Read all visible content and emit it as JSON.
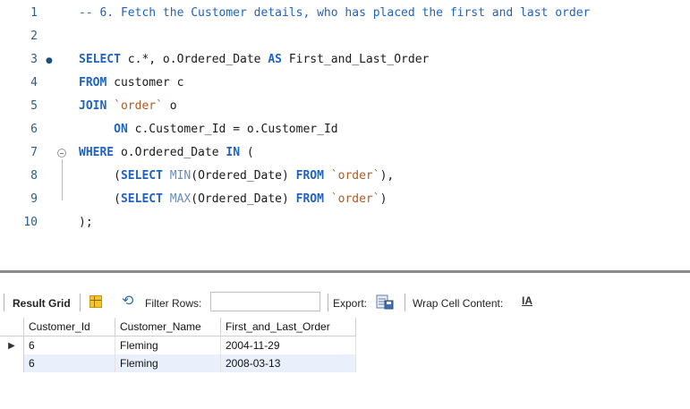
{
  "editor": {
    "lines": [
      {
        "num": "1",
        "tokens": [
          [
            "cm",
            "-- 6. Fetch the Customer details, who has placed the first and last order"
          ]
        ]
      },
      {
        "num": "2",
        "tokens": []
      },
      {
        "num": "3",
        "tokens": [
          [
            "kw",
            "SELECT"
          ],
          [
            "",
            " c.*, o.Ordered_Date "
          ],
          [
            "kw",
            "AS"
          ],
          [
            "",
            " First_and_Last_Order"
          ]
        ]
      },
      {
        "num": "4",
        "tokens": [
          [
            "kw",
            "FROM"
          ],
          [
            "",
            " customer c"
          ]
        ]
      },
      {
        "num": "5",
        "tokens": [
          [
            "kw",
            "JOIN"
          ],
          [
            "",
            " "
          ],
          [
            "str",
            "`order`"
          ],
          [
            "",
            " o"
          ]
        ]
      },
      {
        "num": "6",
        "tokens": [
          [
            "",
            "     "
          ],
          [
            "kw",
            "ON"
          ],
          [
            "",
            " c.Customer_Id = o.Customer_Id"
          ]
        ]
      },
      {
        "num": "7",
        "tokens": [
          [
            "kw",
            "WHERE"
          ],
          [
            "",
            " o.Ordered_Date "
          ],
          [
            "kw",
            "IN"
          ],
          [
            "",
            " ("
          ]
        ]
      },
      {
        "num": "8",
        "tokens": [
          [
            "",
            "     ("
          ],
          [
            "kw",
            "SELECT"
          ],
          [
            "",
            " "
          ],
          [
            "fn",
            "MIN"
          ],
          [
            "",
            "(Ordered_Date) "
          ],
          [
            "kw",
            "FROM"
          ],
          [
            "",
            " "
          ],
          [
            "str",
            "`order`"
          ],
          [
            "",
            "),"
          ]
        ]
      },
      {
        "num": "9",
        "tokens": [
          [
            "",
            "     ("
          ],
          [
            "kw",
            "SELECT"
          ],
          [
            "",
            " "
          ],
          [
            "fn",
            "MAX"
          ],
          [
            "",
            "(Ordered_Date) "
          ],
          [
            "kw",
            "FROM"
          ],
          [
            "",
            " "
          ],
          [
            "str",
            "`order`"
          ],
          [
            "",
            ")"
          ]
        ]
      },
      {
        "num": "10",
        "tokens": [
          [
            "",
            ");"
          ]
        ]
      }
    ]
  },
  "toolbar": {
    "result_grid_label": "Result Grid",
    "filter_rows_label": "Filter Rows:",
    "filter_value": "",
    "export_label": "Export:",
    "wrap_label": "Wrap Cell Content:",
    "wrap_icon_text": "IA"
  },
  "grid": {
    "columns": [
      "Customer_Id",
      "Customer_Name",
      "First_and_Last_Order"
    ],
    "rows": [
      [
        "6",
        "Fleming",
        "2004-11-29"
      ],
      [
        "6",
        "Fleming",
        "2008-03-13"
      ]
    ]
  }
}
